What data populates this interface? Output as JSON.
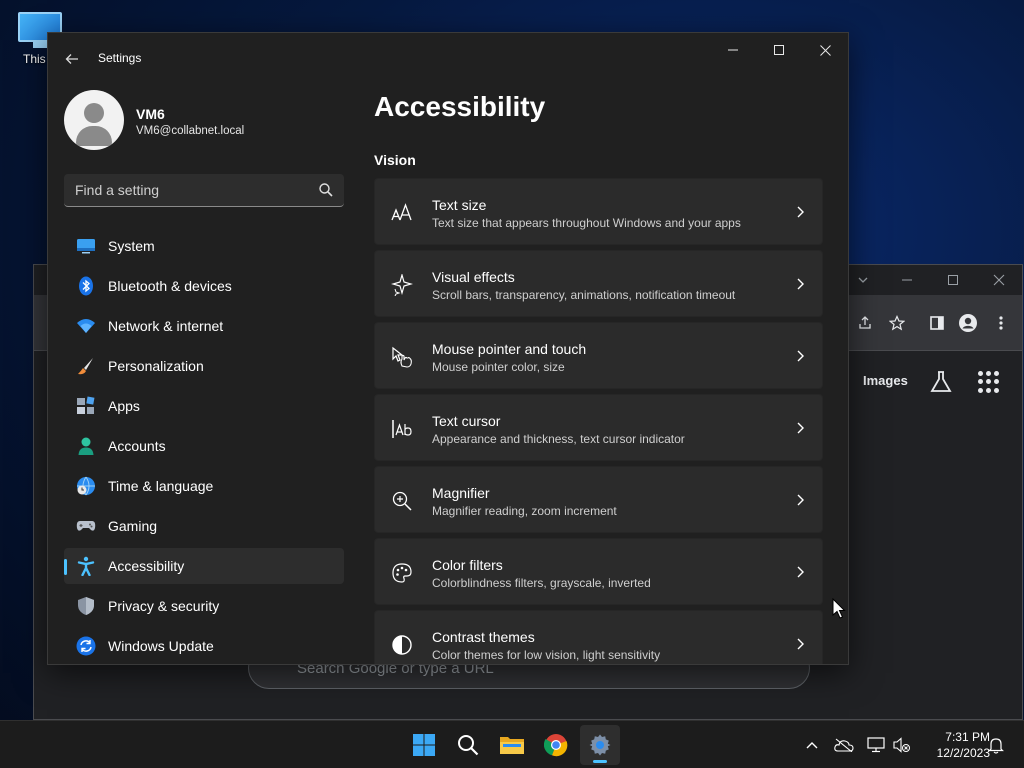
{
  "desktop": {
    "icon_label": "This P"
  },
  "browser": {
    "images_label": "Images",
    "search_placeholder": "Search Google or type a URL"
  },
  "settings": {
    "app_title": "Settings",
    "user": {
      "name": "VM6",
      "email": "VM6@collabnet.local"
    },
    "search_placeholder": "Find a setting",
    "nav": [
      {
        "label": "System",
        "icon": "system-icon"
      },
      {
        "label": "Bluetooth & devices",
        "icon": "bluetooth-icon"
      },
      {
        "label": "Network & internet",
        "icon": "wifi-icon"
      },
      {
        "label": "Personalization",
        "icon": "paintbrush-icon"
      },
      {
        "label": "Apps",
        "icon": "apps-icon"
      },
      {
        "label": "Accounts",
        "icon": "accounts-icon"
      },
      {
        "label": "Time & language",
        "icon": "globe-clock-icon"
      },
      {
        "label": "Gaming",
        "icon": "gamepad-icon"
      },
      {
        "label": "Accessibility",
        "icon": "accessibility-icon",
        "active": true
      },
      {
        "label": "Privacy & security",
        "icon": "shield-icon"
      },
      {
        "label": "Windows Update",
        "icon": "update-icon"
      }
    ],
    "page_title": "Accessibility",
    "section_title": "Vision",
    "cards": [
      {
        "title": "Text size",
        "subtitle": "Text size that appears throughout Windows and your apps",
        "icon": "text-size-icon"
      },
      {
        "title": "Visual effects",
        "subtitle": "Scroll bars, transparency, animations, notification timeout",
        "icon": "sparkle-icon"
      },
      {
        "title": "Mouse pointer and touch",
        "subtitle": "Mouse pointer color, size",
        "icon": "pointer-hand-icon"
      },
      {
        "title": "Text cursor",
        "subtitle": "Appearance and thickness, text cursor indicator",
        "icon": "text-cursor-icon"
      },
      {
        "title": "Magnifier",
        "subtitle": "Magnifier reading, zoom increment",
        "icon": "magnifier-icon"
      },
      {
        "title": "Color filters",
        "subtitle": "Colorblindness filters, grayscale, inverted",
        "icon": "palette-icon"
      },
      {
        "title": "Contrast themes",
        "subtitle": "Color themes for low vision, light sensitivity",
        "icon": "contrast-icon"
      }
    ]
  },
  "taskbar": {
    "time": "7:31 PM",
    "date": "12/2/2023"
  },
  "colors": {
    "accent": "#4cc2ff",
    "window_bg": "#202020",
    "card_bg": "#2b2b2b",
    "taskbar_bg": "#1c1c1c"
  }
}
